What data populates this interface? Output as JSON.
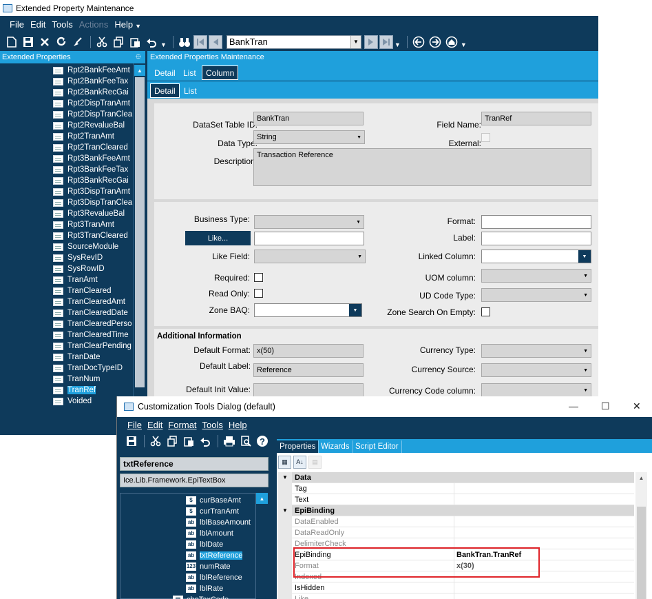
{
  "main_window": {
    "title": "Extended Property Maintenance",
    "menu": [
      "File",
      "Edit",
      "Tools",
      "Actions",
      "Help"
    ],
    "key_field": "BankTran",
    "left_panel_title": "Extended Properties",
    "left_panel_pin": "⯐",
    "right_panel_title": "Extended Properties Maintenance",
    "tree": [
      "Rpt2BankFeeAmt",
      "Rpt2BankFeeTax",
      "Rpt2BankRecGai",
      "Rpt2DispTranAmt",
      "Rpt2DispTranClea",
      "Rpt2RevalueBal",
      "Rpt2TranAmt",
      "Rpt2TranCleared",
      "Rpt3BankFeeAmt",
      "Rpt3BankFeeTax",
      "Rpt3BankRecGai",
      "Rpt3DispTranAmt",
      "Rpt3DispTranClea",
      "Rpt3RevalueBal",
      "Rpt3TranAmt",
      "Rpt3TranCleared",
      "SourceModule",
      "SysRevID",
      "SysRowID",
      "TranAmt",
      "TranCleared",
      "TranClearedAmt",
      "TranClearedDate",
      "TranClearedPerso",
      "TranClearedTime",
      "TranClearPending",
      "TranDate",
      "TranDocTypeID",
      "TranNum",
      "TranRef",
      "Voided"
    ],
    "tree_selected": "TranRef",
    "tabs_top": [
      "Detail",
      "List",
      "Column"
    ],
    "tabs_sub": [
      "Detail",
      "List"
    ],
    "form": {
      "dataset_table_label": "DataSet Table ID:",
      "dataset_table_value": "BankTran",
      "field_name_label": "Field Name:",
      "field_name_value": "TranRef",
      "data_type_label": "Data Type:",
      "data_type_value": "String",
      "external_label": "External:",
      "description_label": "Description:",
      "description_value": "Transaction Reference",
      "business_type_label": "Business Type:",
      "format_label": "Format:",
      "like_button": "Like...",
      "label_label": "Label:",
      "like_field_label": "Like Field:",
      "linked_column_label": "Linked Column:",
      "required_label": "Required:",
      "uom_column_label": "UOM column:",
      "read_only_label": "Read Only:",
      "ud_code_type_label": "UD Code Type:",
      "zone_baq_label": "Zone BAQ:",
      "zone_search_label": "Zone Search On Empty:",
      "additional_info_heading": "Additional Information",
      "default_format_label": "Default Format:",
      "default_format_value": "x(50)",
      "currency_type_label": "Currency Type:",
      "default_label_label": "Default Label:",
      "default_label_value": "Reference",
      "currency_source_label": "Currency Source:",
      "default_init_label": "Default Init Value:",
      "currency_code_label": "Currency Code column:"
    }
  },
  "dialog": {
    "title": "Customization Tools Dialog (default)",
    "window_controls": [
      "—",
      "☐",
      "✕"
    ],
    "menu": [
      "File",
      "Edit",
      "Format",
      "Tools",
      "Help"
    ],
    "control_name": "txtReference",
    "control_type": "Ice.Lib.Framework.EpiTextBox",
    "control_tree": [
      {
        "icon": "$",
        "label": "curBaseAmt"
      },
      {
        "icon": "$",
        "label": "curTranAmt"
      },
      {
        "icon": "ab",
        "label": "lblBaseAmount"
      },
      {
        "icon": "ab",
        "label": "lblAmount"
      },
      {
        "icon": "ab",
        "label": "lblDate"
      },
      {
        "icon": "ab",
        "label": "txtReference"
      },
      {
        "icon": "123",
        "label": "numRate"
      },
      {
        "icon": "ab",
        "label": "lblReference"
      },
      {
        "icon": "ab",
        "label": "lblRate"
      },
      {
        "icon": "▤",
        "label": "cboTaxCode"
      }
    ],
    "control_selected": "txtReference",
    "prop_tabs": [
      "Properties",
      "Wizards",
      "Script Editor"
    ],
    "prop_rows": [
      {
        "kind": "cat",
        "name": "Data",
        "value": ""
      },
      {
        "kind": "row",
        "name": "Tag",
        "value": ""
      },
      {
        "kind": "row",
        "name": "Text",
        "value": ""
      },
      {
        "kind": "cat",
        "name": "EpiBinding",
        "value": ""
      },
      {
        "kind": "grey",
        "name": "DataEnabled",
        "value": ""
      },
      {
        "kind": "grey",
        "name": "DataReadOnly",
        "value": ""
      },
      {
        "kind": "grey",
        "name": "DelimiterCheck",
        "value": ""
      },
      {
        "kind": "row",
        "name": "EpiBinding",
        "value": "BankTran.TranRef"
      },
      {
        "kind": "grey",
        "name": "Format",
        "value": "x(30)"
      },
      {
        "kind": "grey",
        "name": "Indexed",
        "value": ""
      },
      {
        "kind": "row",
        "name": "IsHidden",
        "value": ""
      },
      {
        "kind": "grey",
        "name": "Like",
        "value": ""
      }
    ],
    "highlight_color": "#e0242a"
  },
  "colors": {
    "dark_navy": "#0e3a5b",
    "accent_blue": "#1fa0dc",
    "form_bg": "#ececec"
  }
}
